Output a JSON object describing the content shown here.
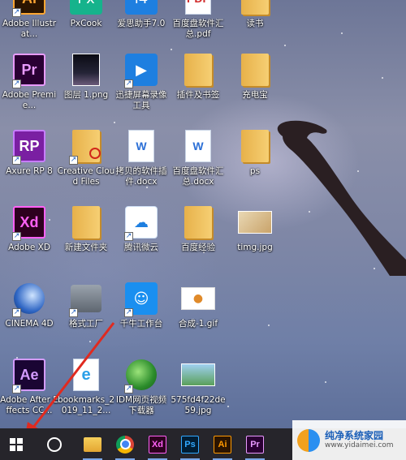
{
  "desktop": {
    "icons": [
      {
        "label": "Adobe Illustrat...",
        "icon": "illustrator-icon"
      },
      {
        "label": "PxCook",
        "icon": "pxcook-icon"
      },
      {
        "label": "爱思助手7.0",
        "icon": "aisi-assistant-icon"
      },
      {
        "label": "百度盘软件汇总.pdf",
        "icon": "pdf-file-icon"
      },
      {
        "label": "读书",
        "icon": "folder-icon"
      },
      {
        "label": "Adobe Premie...",
        "icon": "premiere-icon",
        "glyph": "Pr"
      },
      {
        "label": "图层 1.png",
        "icon": "image-file-icon"
      },
      {
        "label": "迅捷屏幕录像工具",
        "icon": "screen-recorder-icon"
      },
      {
        "label": "插件及书签",
        "icon": "folder-icon"
      },
      {
        "label": "充电宝",
        "icon": "folder-icon"
      },
      {
        "label": "Axure RP 8",
        "icon": "axure-icon",
        "glyph": "RP"
      },
      {
        "label": "Creative Cloud Files",
        "icon": "creative-cloud-folder-icon"
      },
      {
        "label": "拷贝的软件插件.docx",
        "icon": "word-document-icon",
        "glyph": "W"
      },
      {
        "label": "百度盘软件汇总.docx",
        "icon": "word-document-icon",
        "glyph": "W"
      },
      {
        "label": "ps",
        "icon": "folder-icon"
      },
      {
        "label": "Adobe XD",
        "icon": "xd-icon",
        "glyph": "Xd"
      },
      {
        "label": "新建文件夹",
        "icon": "folder-icon"
      },
      {
        "label": "腾讯微云",
        "icon": "weiyun-icon"
      },
      {
        "label": "百度经验",
        "icon": "folder-icon"
      },
      {
        "label": "timg.jpg",
        "icon": "image-file-icon"
      },
      {
        "label": "CINEMA 4D",
        "icon": "cinema4d-icon"
      },
      {
        "label": "格式工厂",
        "icon": "format-factory-icon"
      },
      {
        "label": "千牛工作台",
        "icon": "qianniu-icon"
      },
      {
        "label": "合成-1.gif",
        "icon": "gif-file-icon"
      },
      {
        "label": "Adobe After Effects CC...",
        "icon": "after-effects-icon",
        "glyph": "Ae"
      },
      {
        "label": "bookmarks_2019_11_2...",
        "icon": "bookmarks-html-icon"
      },
      {
        "label": "IDM网页视频下载器",
        "icon": "idm-icon"
      },
      {
        "label": "575fd4f22de59.jpg",
        "icon": "image-file-icon"
      }
    ]
  },
  "taskbar": {
    "start_icon": "windows-start-icon",
    "search_icon": "cortana-circle-icon",
    "pinned": [
      {
        "name": "file-explorer-icon"
      },
      {
        "name": "chrome-icon"
      },
      {
        "name": "xd-taskbar-icon",
        "glyph": "Xd"
      },
      {
        "name": "photoshop-taskbar-icon",
        "glyph": "Ps"
      },
      {
        "name": "illustrator-taskbar-icon",
        "glyph": "Ai"
      },
      {
        "name": "premiere-taskbar-icon",
        "glyph": "Pr"
      }
    ]
  },
  "watermark": {
    "title": "纯净系统家园",
    "url": "www.yidaimei.com"
  },
  "colors": {
    "taskbar_bg": "#26252b",
    "annotation_arrow": "#e02a1f"
  }
}
